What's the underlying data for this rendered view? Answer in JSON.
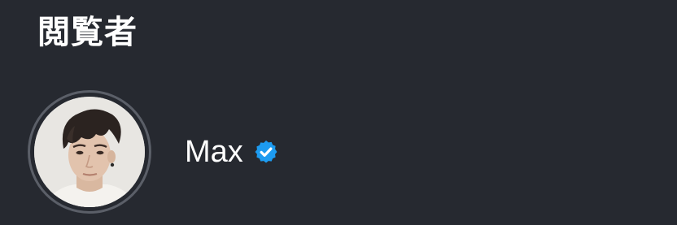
{
  "header": {
    "title": "閲覧者"
  },
  "viewers": [
    {
      "name": "Max",
      "verified": true,
      "avatar_icon": "profile-photo",
      "badge_icon": "verified-badge-icon",
      "badge_color": "#1d9bf0"
    }
  ],
  "colors": {
    "background": "#262930",
    "avatar_ring": "#5b5f68",
    "text": "#ffffff",
    "verified": "#1d9bf0"
  }
}
